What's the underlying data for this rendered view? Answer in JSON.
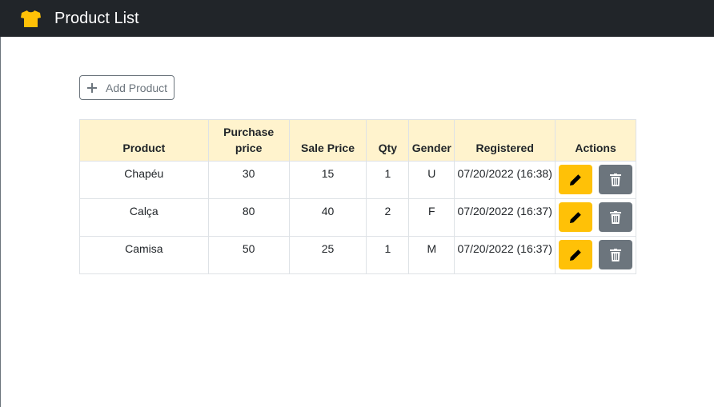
{
  "header": {
    "title": "Product List",
    "icon": "tshirt-icon",
    "icon_color": "#ffc107",
    "background": "#212529"
  },
  "toolbar": {
    "add_label": "Add Product",
    "add_icon": "plus-icon"
  },
  "table": {
    "columns": [
      "Product",
      "Purchase price",
      "Sale Price",
      "Qty",
      "Gender",
      "Registered",
      "Actions"
    ],
    "header_background": "#fff3cd",
    "rows": [
      {
        "product": "Chapéu",
        "purchase_price": "30",
        "sale_price": "15",
        "qty": "1",
        "gender": "U",
        "registered": "07/20/2022 (16:38)"
      },
      {
        "product": "Calça",
        "purchase_price": "80",
        "sale_price": "40",
        "qty": "2",
        "gender": "F",
        "registered": "07/20/2022 (16:37)"
      },
      {
        "product": "Camisa",
        "purchase_price": "50",
        "sale_price": "25",
        "qty": "1",
        "gender": "M",
        "registered": "07/20/2022 (16:37)"
      }
    ],
    "edit_icon": "pencil-icon",
    "edit_color": "#ffc107",
    "delete_icon": "trash-icon",
    "delete_color": "#6c757d"
  }
}
